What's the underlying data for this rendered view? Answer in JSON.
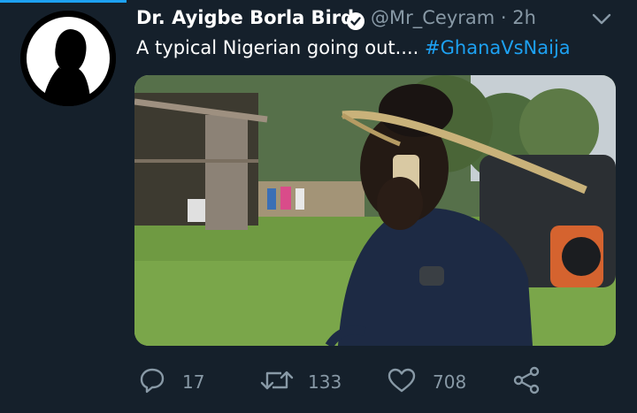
{
  "tweet": {
    "display_name": "Dr. Ayigbe Borla Bird",
    "handle_time": "@Mr_Ceyram · 2h",
    "text": "A typical Nigerian going out.... ",
    "hashtag": "#GhanaVsNaija"
  },
  "actions": {
    "reply_count": "17",
    "retweet_count": "133",
    "like_count": "708"
  },
  "colors": {
    "background": "#15202b",
    "accent": "#1da1f2",
    "muted": "#8899a6"
  },
  "icons": {
    "verified": "verified-badge-icon",
    "menu": "chevron-down-icon",
    "reply": "reply-icon",
    "retweet": "retweet-icon",
    "like": "heart-icon",
    "share": "share-icon"
  }
}
